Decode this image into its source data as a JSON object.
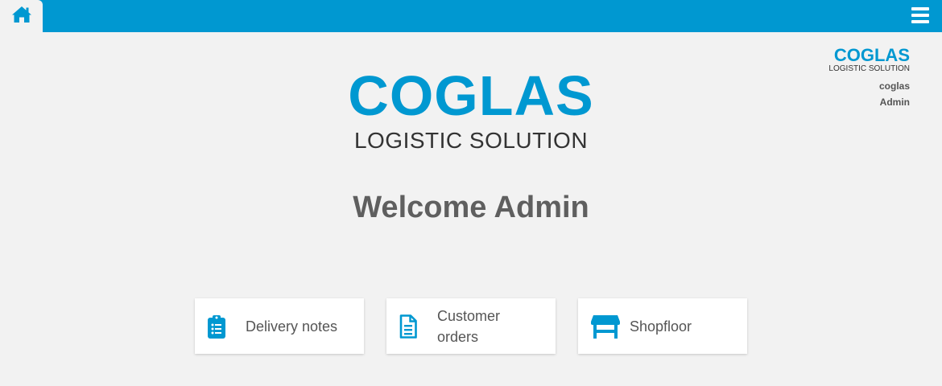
{
  "topbar": {
    "color": "#0098d1",
    "home_icon": "home-icon",
    "menu_icon": "hamburger-menu-icon"
  },
  "user_panel": {
    "logo_name": "COGLAS",
    "logo_subtitle": "LOGISTIC SOLUTION",
    "company": "coglas",
    "role": "Admin"
  },
  "main_logo": {
    "name": "COGLAS",
    "subtitle": "LOGISTIC SOLUTION"
  },
  "welcome_text": "Welcome Admin",
  "tiles": [
    {
      "label": "Delivery notes",
      "icon": "clipboard-list-icon"
    },
    {
      "label_line1": "Customer",
      "label_line2": "orders",
      "icon": "document-icon"
    },
    {
      "label": "Shopfloor",
      "icon": "store-icon"
    }
  ],
  "accent_color": "#0098d1"
}
